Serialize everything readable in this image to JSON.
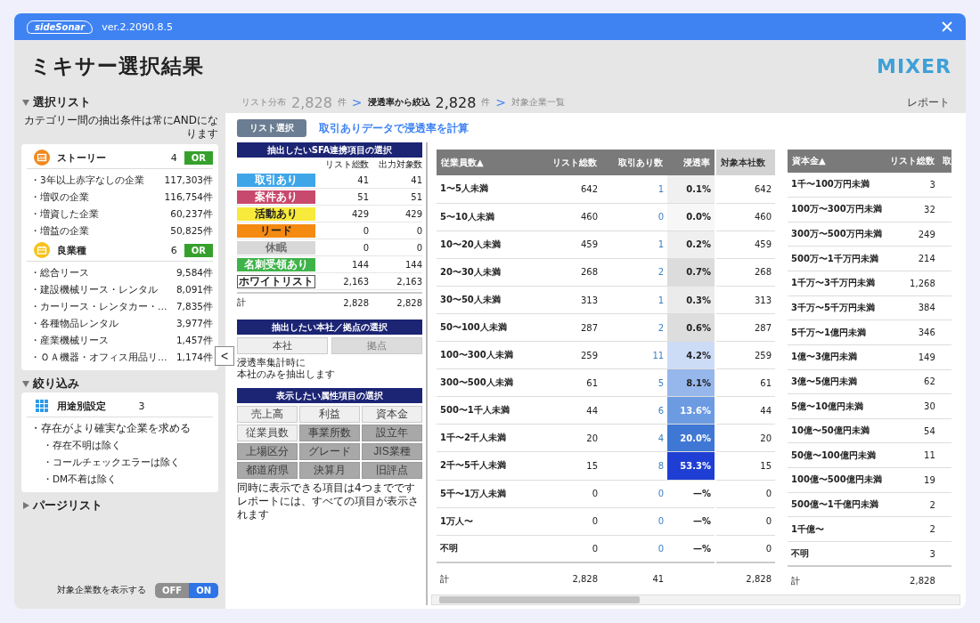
{
  "titlebar": {
    "logo": "sideSonar",
    "version": "ver.2.2090.8.5"
  },
  "header": {
    "title": "ミキサー選択結果",
    "brand": "MIXER"
  },
  "sidebar": {
    "sections": [
      {
        "title": "選択リスト",
        "expanded": true,
        "note": "カテゴリー間の抽出条件は常にANDになります",
        "groups": [
          {
            "kind": "story",
            "title": "ストーリー",
            "count": "4",
            "badge": "OR",
            "items": [
              {
                "label": "・3年以上赤字なしの企業",
                "count": "117,303件"
              },
              {
                "label": "・増収の企業",
                "count": "116,754件"
              },
              {
                "label": "・増資した企業",
                "count": "60,237件"
              },
              {
                "label": "・増益の企業",
                "count": "50,825件"
              }
            ]
          },
          {
            "kind": "industry",
            "title": "良業種",
            "count": "6",
            "badge": "OR",
            "items": [
              {
                "label": "・総合リース",
                "count": "9,584件"
              },
              {
                "label": "・建設機械リース・レンタル",
                "count": "8,091件"
              },
              {
                "label": "・カーリース・レンタカー・…",
                "count": "7,835件"
              },
              {
                "label": "・各種物品レンタル",
                "count": "3,977件"
              },
              {
                "label": "・産業機械リース",
                "count": "1,457件"
              },
              {
                "label": "・ＯＡ機器・オフィス用品リ…",
                "count": "1,174件"
              }
            ]
          }
        ]
      },
      {
        "title": "絞り込み",
        "expanded": true,
        "groups": [
          {
            "kind": "usage",
            "title": "用途別設定",
            "count": "3",
            "items": [
              {
                "label": "・存在がより確実な企業を求める",
                "children": [
                  {
                    "label": "・存在不明は除く"
                  },
                  {
                    "label": "・コールチェックエラーは除く"
                  },
                  {
                    "label": "・DM不着は除く"
                  }
                ]
              }
            ]
          }
        ]
      },
      {
        "title": "パージリスト",
        "expanded": false
      }
    ],
    "collapse_button": "<",
    "toggle": {
      "label": "対象企業数を表示する",
      "off_label": "OFF",
      "on_label": "ON",
      "on": true
    }
  },
  "breadcrumb": {
    "separator": ">",
    "steps": [
      {
        "label": "リスト分布",
        "count": "2,828",
        "unit": "件",
        "selected": false
      },
      {
        "label": "浸透率から絞込",
        "count": "2,828",
        "unit": "件",
        "selected": true
      },
      {
        "label": "対象企業一覧",
        "selected": false
      }
    ],
    "report": "レポート"
  },
  "panel": {
    "tab": "リスト選択",
    "heading": "取引ありデータで浸透率を計算",
    "sfa": {
      "title": "抽出したいSFA連携項目の選択",
      "columns": [
        "リスト総数",
        "出力対象数"
      ],
      "items": [
        {
          "label": "取引あり",
          "kind": "filled",
          "color": "#3ea6e8",
          "disabled": false,
          "total": "41",
          "output": "41"
        },
        {
          "label": "案件あり",
          "kind": "filled",
          "color": "#c8496e",
          "disabled": false,
          "total": "51",
          "output": "51"
        },
        {
          "label": "活動あり",
          "kind": "filled",
          "color": "#f7ea3a",
          "disabled": false,
          "total": "429",
          "output": "429"
        },
        {
          "label": "リード",
          "kind": "filled",
          "color": "#f58a12",
          "disabled": false,
          "total": "0",
          "output": "0"
        },
        {
          "label": "休眠",
          "kind": "filled",
          "color": "#d8d8d8",
          "disabled": true,
          "total": "0",
          "output": "0"
        },
        {
          "label": "名刺受領あり",
          "kind": "filled",
          "color": "#3fb34a",
          "disabled": false,
          "total": "144",
          "output": "144"
        },
        {
          "label": "ホワイトリスト",
          "kind": "outline",
          "color": "#ffffff",
          "disabled": false,
          "total": "2,163",
          "output": "2,163"
        }
      ],
      "sum": {
        "label": "計",
        "total": "2,828",
        "output": "2,828"
      }
    },
    "hq": {
      "title": "抽出したい本社／拠点の選択",
      "options": [
        {
          "label": "本社",
          "selected": true
        },
        {
          "label": "拠点",
          "selected": false
        }
      ],
      "note_lines": [
        "浸透率集計時に",
        "本社のみを抽出します"
      ]
    },
    "attributes": {
      "title": "表示したい属性項目の選択",
      "options": [
        {
          "label": "売上高",
          "selected": true
        },
        {
          "label": "利益",
          "selected": true
        },
        {
          "label": "資本金",
          "selected": true
        },
        {
          "label": "従業員数",
          "selected": true
        },
        {
          "label": "事業所数",
          "selected": false
        },
        {
          "label": "設立年",
          "selected": false
        },
        {
          "label": "上場区分",
          "selected": false
        },
        {
          "label": "グレード",
          "selected": false
        },
        {
          "label": "JIS業種",
          "selected": false
        },
        {
          "label": "都道府県",
          "selected": false
        },
        {
          "label": "決算月",
          "selected": false
        },
        {
          "label": "旧評点",
          "selected": false
        }
      ],
      "note_lines": [
        "同時に表示できる項目は4つまでです",
        "レポートには、すべての項目が表示されます"
      ]
    },
    "employee_table": {
      "columns": [
        "従業員数▲",
        "リスト総数",
        "取引あり数",
        "浸透率"
      ],
      "extra_column": "対象本社数",
      "rows": [
        {
          "label": "1〜5人未満",
          "total": "642",
          "deals": "1",
          "rate": "0.1%",
          "color": "#f0f0f0",
          "target": "642"
        },
        {
          "label": "5〜10人未満",
          "total": "460",
          "deals": "0",
          "rate": "0.0%",
          "color": "#f7f7f7",
          "target": "460"
        },
        {
          "label": "10〜20人未満",
          "total": "459",
          "deals": "1",
          "rate": "0.2%",
          "color": "#efefef",
          "target": "459"
        },
        {
          "label": "20〜30人未満",
          "total": "268",
          "deals": "2",
          "rate": "0.7%",
          "color": "#dcdcdc",
          "target": "268"
        },
        {
          "label": "30〜50人未満",
          "total": "313",
          "deals": "1",
          "rate": "0.3%",
          "color": "#ebebeb",
          "target": "313"
        },
        {
          "label": "50〜100人未満",
          "total": "287",
          "deals": "2",
          "rate": "0.6%",
          "color": "#dddddd",
          "target": "287"
        },
        {
          "label": "100〜300人未満",
          "total": "259",
          "deals": "11",
          "rate": "4.2%",
          "color": "#cddcf6",
          "target": "259"
        },
        {
          "label": "300〜500人未満",
          "total": "61",
          "deals": "5",
          "rate": "8.1%",
          "color": "#96b7ec",
          "target": "61"
        },
        {
          "label": "500〜1千人未満",
          "total": "44",
          "deals": "6",
          "rate": "13.6%",
          "color": "#6c9be2",
          "target": "44"
        },
        {
          "label": "1千〜2千人未満",
          "total": "20",
          "deals": "4",
          "rate": "20.0%",
          "color": "#3f78d4",
          "target": "20"
        },
        {
          "label": "2千〜5千人未満",
          "total": "15",
          "deals": "8",
          "rate": "53.3%",
          "color": "#1f3fd4",
          "target": "15"
        },
        {
          "label": "5千〜1万人未満",
          "total": "0",
          "deals": "0",
          "rate": "—%",
          "color": "#ffffff",
          "target": "0"
        },
        {
          "label": "1万人〜",
          "total": "0",
          "deals": "0",
          "rate": "—%",
          "color": "#ffffff",
          "target": "0"
        },
        {
          "label": "不明",
          "total": "0",
          "deals": "0",
          "rate": "—%",
          "color": "#ffffff",
          "target": "0"
        }
      ],
      "sum": {
        "label": "計",
        "total": "2,828",
        "deals": "41",
        "target": "2,828"
      }
    },
    "capital_table": {
      "columns": [
        "資本金▲",
        "リスト総数",
        "取"
      ],
      "rows": [
        {
          "label": "1千〜100万円未満",
          "total": "3"
        },
        {
          "label": "100万〜300万円未満",
          "total": "32"
        },
        {
          "label": "300万〜500万円未満",
          "total": "249"
        },
        {
          "label": "500万〜1千万円未満",
          "total": "214"
        },
        {
          "label": "1千万〜3千万円未満",
          "total": "1,268"
        },
        {
          "label": "3千万〜5千万円未満",
          "total": "384"
        },
        {
          "label": "5千万〜1億円未満",
          "total": "346"
        },
        {
          "label": "1億〜3億円未満",
          "total": "149"
        },
        {
          "label": "3億〜5億円未満",
          "total": "62"
        },
        {
          "label": "5億〜10億円未満",
          "total": "30"
        },
        {
          "label": "10億〜50億円未満",
          "total": "54"
        },
        {
          "label": "50億〜100億円未満",
          "total": "11"
        },
        {
          "label": "100億〜500億円未満",
          "total": "19"
        },
        {
          "label": "500億〜1千億円未満",
          "total": "2"
        },
        {
          "label": "1千億〜",
          "total": "2"
        },
        {
          "label": "不明",
          "total": "3"
        }
      ],
      "sum": {
        "label": "計",
        "total": "2,828"
      }
    }
  }
}
